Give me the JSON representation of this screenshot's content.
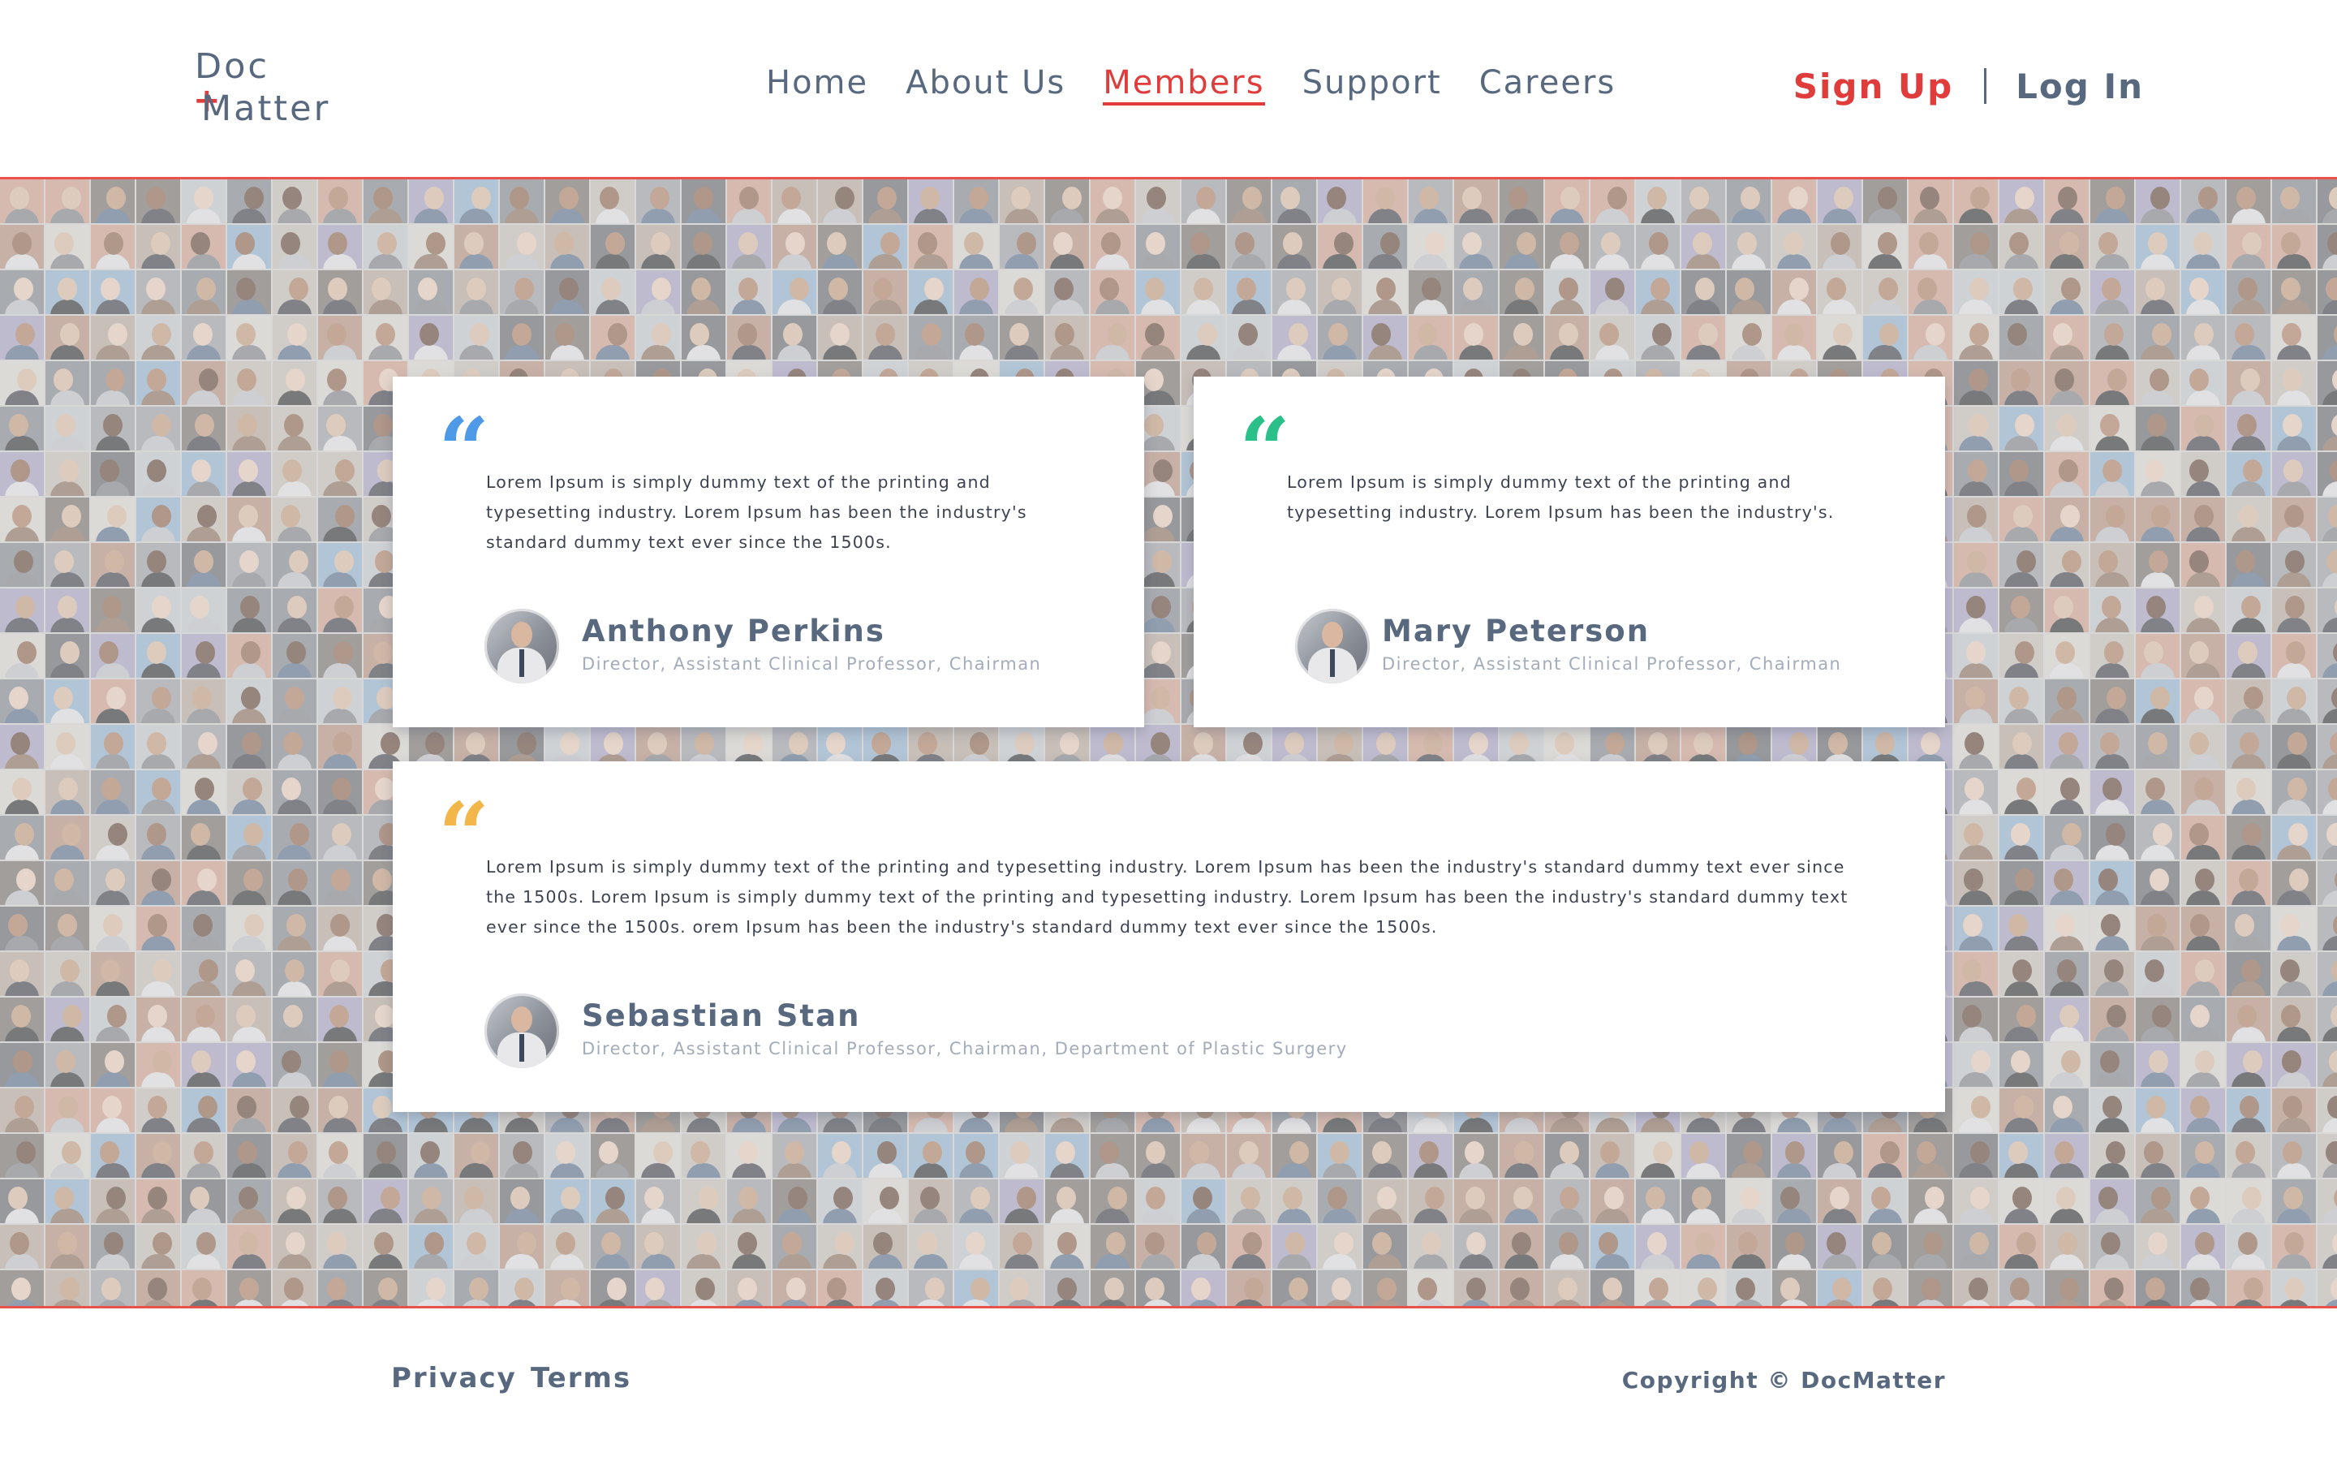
{
  "brand": {
    "logo_top": "Doc",
    "logo_bottom": "Matter",
    "logo_plus": "+"
  },
  "nav": {
    "items": [
      {
        "label": "Home"
      },
      {
        "label": "About Us"
      },
      {
        "label": "Members",
        "active": true
      },
      {
        "label": "Support"
      },
      {
        "label": "Careers"
      }
    ]
  },
  "auth": {
    "signup_label": "Sign Up",
    "login_label": "Log In"
  },
  "testimonials": [
    {
      "quote_mark": "“",
      "quote_color": "#4f9ae8",
      "text": "Lorem Ipsum is simply dummy text of the printing and typesetting industry. Lorem Ipsum has been the industry's standard dummy text ever since the 1500s.",
      "name": "Anthony Perkins",
      "role": "Director, Assistant  Clinical Professor, Chairman"
    },
    {
      "quote_mark": "“",
      "quote_color": "#2bbf8a",
      "text": "Lorem Ipsum is simply dummy text of the printing and typesetting industry. Lorem Ipsum has been the industry's.",
      "name": "Mary Peterson",
      "role": "Director, Assistant  Clinical Professor, Chairman"
    },
    {
      "quote_mark": "“",
      "quote_color": "#f2b64a",
      "text": "Lorem Ipsum is simply dummy text of the printing and typesetting industry. Lorem Ipsum has been the industry's standard dummy text ever since the 1500s. Lorem Ipsum is simply dummy text of the printing and typesetting industry. Lorem Ipsum has been the industry's standard dummy text ever since the 1500s. orem Ipsum has been the industry's standard dummy text ever since the 1500s.",
      "name": "Sebastian Stan",
      "role": "Director, Assistant  Clinical Professor, Chairman, Department of Plastic Surgery"
    }
  ],
  "footer": {
    "privacy_label": "Privacy",
    "terms_label": "Terms",
    "copyright": "Copyright © DocMatter"
  },
  "colors": {
    "accent": "#e03c3c",
    "text": "#58697f",
    "muted": "#a3acba"
  }
}
